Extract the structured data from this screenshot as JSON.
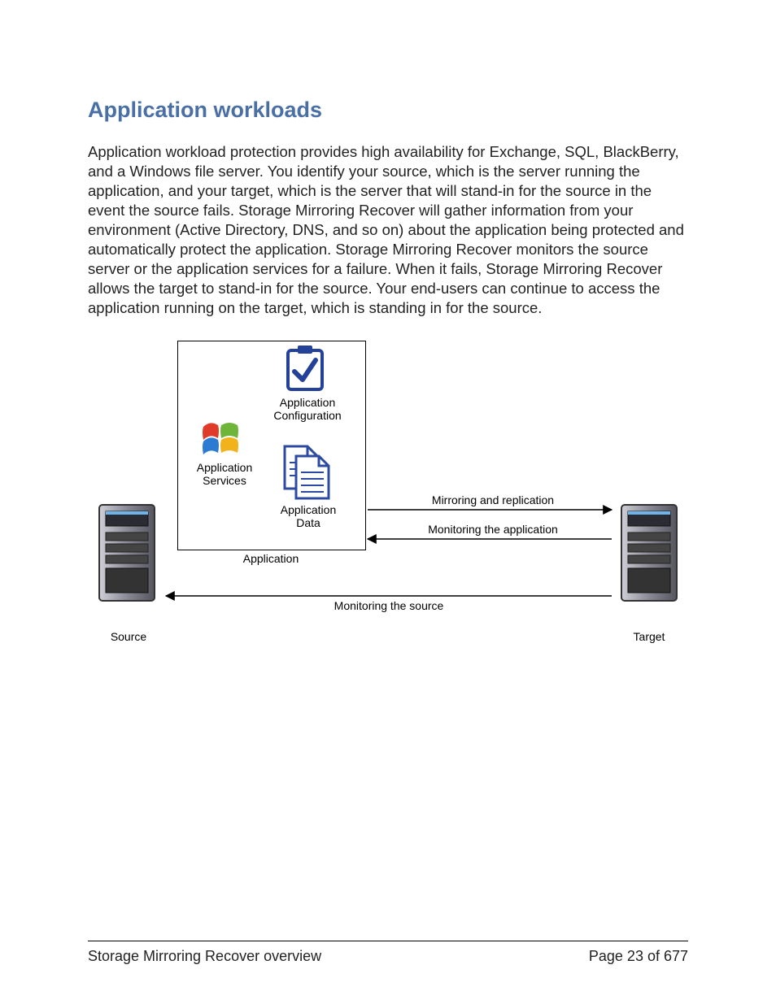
{
  "heading": "Application workloads",
  "paragraph": "Application workload protection provides high availability for Exchange, SQL, BlackBerry, and a Windows file server. You identify your source, which is the server running the application, and your target, which is the server that will stand-in for the source in the event the source fails. Storage Mirroring Recover will gather information from your environment (Active Directory, DNS, and so on) about the application being protected and automatically protect the application. Storage Mirroring Recover monitors the source server or the application services for a failure. When it fails, Storage Mirroring Recover allows the target to stand-in for the source. Your end-users can continue to access the application running on the target, which is standing in for the source.",
  "diagram": {
    "source_label": "Source",
    "target_label": "Target",
    "application_label": "Application",
    "app_services_label": "Application\nServices",
    "app_config_label": "Application\nConfiguration",
    "app_data_label": "Application\nData",
    "arrow1": "Mirroring and replication",
    "arrow2": "Monitoring the application",
    "arrow3": "Monitoring the source"
  },
  "footer": {
    "left": "Storage Mirroring Recover overview",
    "right": "Page 23 of 677"
  }
}
